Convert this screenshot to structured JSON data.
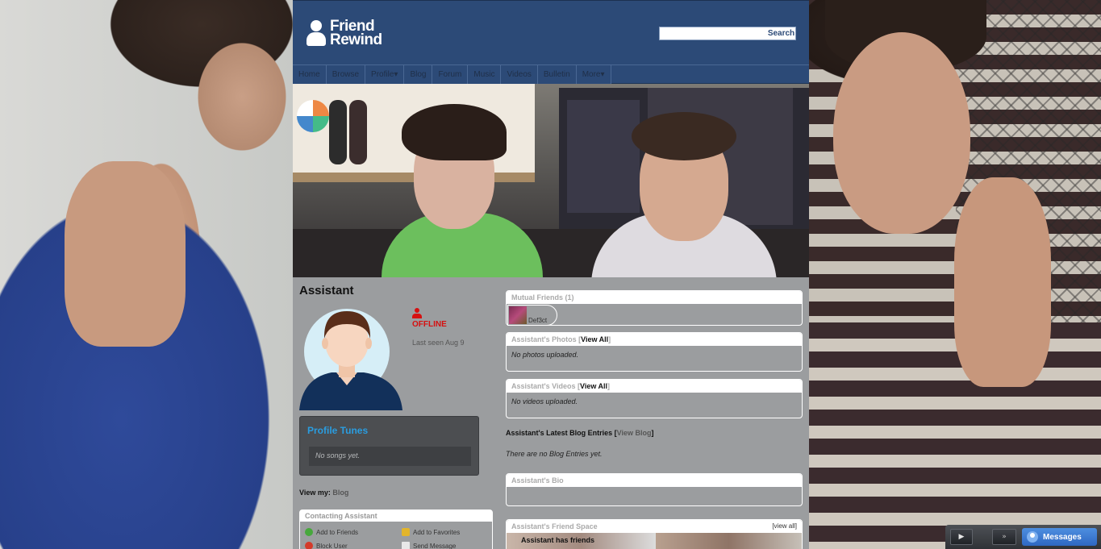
{
  "header": {
    "logo_line1": "Friend",
    "logo_line2": "Rewind",
    "search_button": "Search",
    "search_value": ""
  },
  "nav": {
    "items": [
      "Home",
      "Browse",
      "Profile",
      "Blog",
      "Forum",
      "Music",
      "Videos",
      "Bulletin",
      "More"
    ]
  },
  "profile": {
    "name": "Assistant",
    "status": "OFFLINE",
    "last_seen": "Last seen Aug 9",
    "tunes_title": "Profile Tunes",
    "tunes_empty": "No songs yet.",
    "view_my_label": "View my:",
    "view_my_link": "Blog"
  },
  "contact": {
    "title": "Contacting Assistant",
    "add_friends": "Add to Friends",
    "add_favorites": "Add to Favorites",
    "block_user": "Block User",
    "send_message": "Send Message"
  },
  "mutual": {
    "title": "Mutual Friends (1)",
    "friend_name": "Def3ct"
  },
  "photos": {
    "title": "Assistant's Photos [",
    "view_all": "View All",
    "close": "]",
    "empty": "No photos uploaded."
  },
  "videos": {
    "title": "Assistant's Videos [",
    "view_all": "View All",
    "close": "]",
    "empty": "No videos uploaded."
  },
  "blog": {
    "title": "Assistant's Latest Blog Entries [",
    "view_blog": "View Blog",
    "close": "]",
    "empty": "There are no Blog Entries yet."
  },
  "bio": {
    "title": "Assistant's Bio"
  },
  "friend_space": {
    "title": "Assistant's Friend Space",
    "view_all": "[view all]",
    "has_friends": "Assistant has  friends"
  },
  "player": {
    "play": "▶",
    "skip": "»",
    "messages": "Messages"
  }
}
